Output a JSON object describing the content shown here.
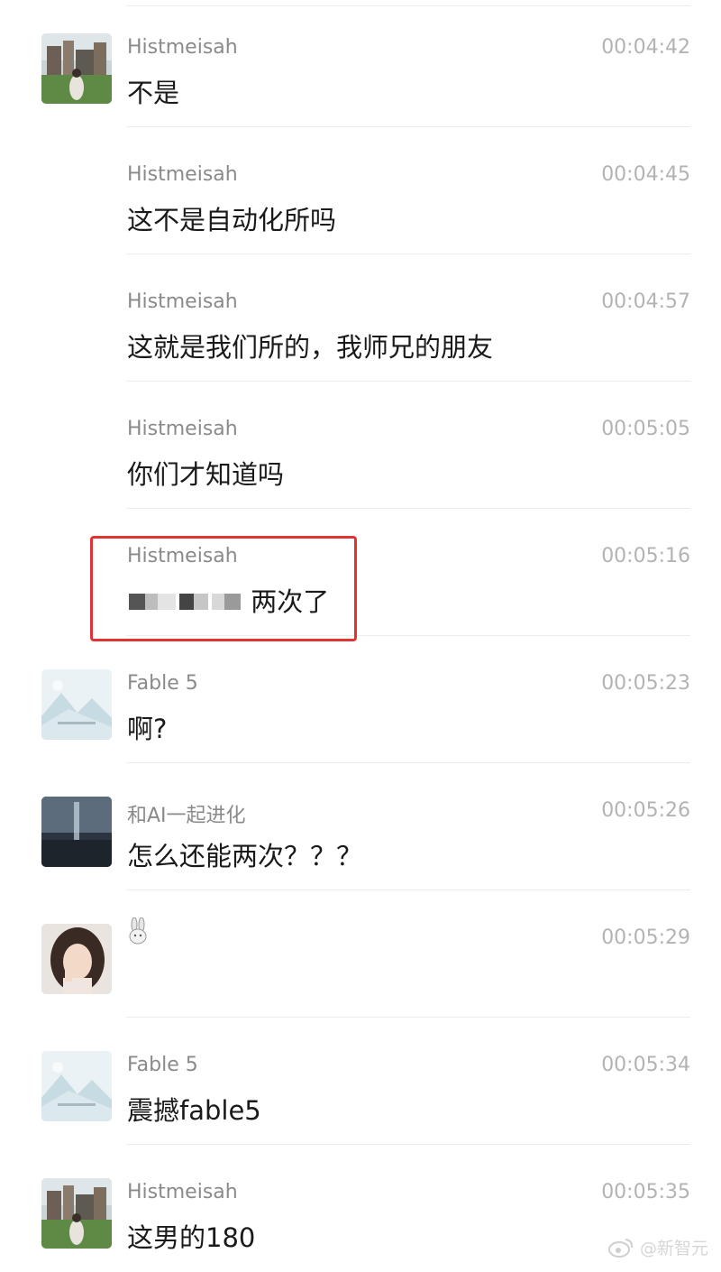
{
  "messages": [
    {
      "sender": "Histmeisah",
      "time": "00:04:42",
      "text": "不是",
      "avatar": "landscape-avatar"
    },
    {
      "sender": "Histmeisah",
      "time": "00:04:45",
      "text": "这不是自动化所吗",
      "avatar": null
    },
    {
      "sender": "Histmeisah",
      "time": "00:04:57",
      "text": "这就是我们所的，我师兄的朋友",
      "avatar": null
    },
    {
      "sender": "Histmeisah",
      "time": "00:05:05",
      "text": "你们才知道吗",
      "avatar": null
    },
    {
      "sender": "Histmeisah",
      "time": "00:05:16",
      "text": "两次了",
      "avatar": null,
      "redacted_prefix": true,
      "highlighted": true
    },
    {
      "sender": "Fable 5",
      "time": "00:05:23",
      "text": "啊?",
      "avatar": "mountain-avatar"
    },
    {
      "sender": "和AI一起进化",
      "time": "00:05:26",
      "text": "怎么还能两次？？？",
      "avatar": "night-avatar"
    },
    {
      "sender": "",
      "time": "00:05:29",
      "text": "",
      "avatar": "woman-avatar",
      "name_icon": "bunny-icon"
    },
    {
      "sender": "Fable 5",
      "time": "00:05:34",
      "text": "震撼fable5",
      "avatar": "mountain-avatar"
    },
    {
      "sender": "Histmeisah",
      "time": "00:05:35",
      "text": "这男的180",
      "avatar": "landscape-avatar"
    }
  ],
  "watermark": {
    "text": "@新智元",
    "icon": "weibo-icon"
  },
  "colors": {
    "highlight": "#e03333",
    "time": "#b3b3b3",
    "sender": "#8a8a8a"
  }
}
